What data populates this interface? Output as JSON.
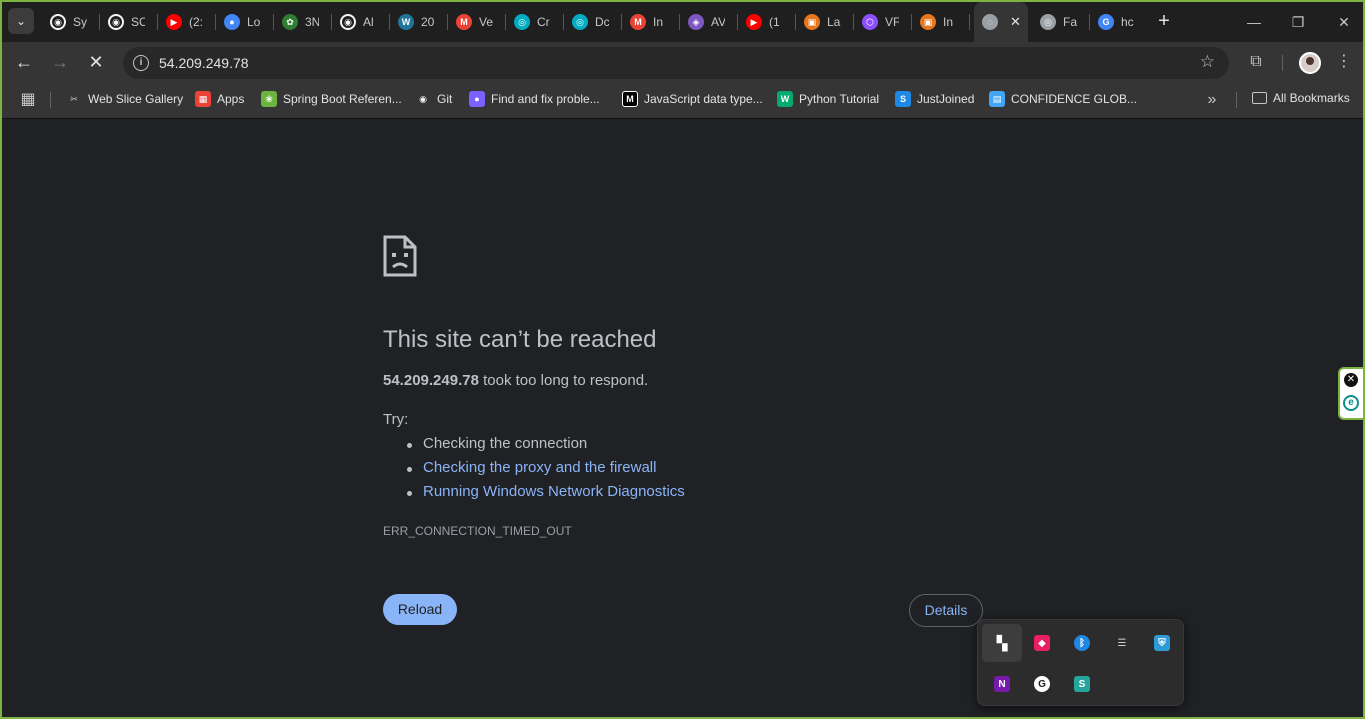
{
  "tabs": [
    {
      "title": "Sy",
      "icon": "github-icon",
      "color": "#f5f5f5"
    },
    {
      "title": "SC",
      "icon": "github-icon",
      "color": "#f5f5f5"
    },
    {
      "title": "(2:",
      "icon": "youtube-icon",
      "color": "#ff0000"
    },
    {
      "title": "Lo",
      "icon": "firebase-icon",
      "color": "#4285f4"
    },
    {
      "title": "3N",
      "icon": "tree-icon",
      "color": "#2e7d32"
    },
    {
      "title": "Al",
      "icon": "github-icon",
      "color": "#f5f5f5"
    },
    {
      "title": "20",
      "icon": "wordpress-icon",
      "color": "#21759b"
    },
    {
      "title": "Ve",
      "icon": "gmail-icon",
      "color": "#ea4335"
    },
    {
      "title": "Cr",
      "icon": "eye-icon",
      "color": "#00acc1"
    },
    {
      "title": "Dc",
      "icon": "eye-icon",
      "color": "#00acc1"
    },
    {
      "title": "In",
      "icon": "gmail-icon",
      "color": "#ea4335"
    },
    {
      "title": "AV",
      "icon": "aws-cube-icon",
      "color": "#7e57c2"
    },
    {
      "title": "(1",
      "icon": "youtube-icon",
      "color": "#ff0000"
    },
    {
      "title": "La",
      "icon": "aws-orange-icon",
      "color": "#e8761c"
    },
    {
      "title": "VF",
      "icon": "vpc-icon",
      "color": "#8c4fff"
    },
    {
      "title": "In",
      "icon": "aws-orange-icon",
      "color": "#e8761c"
    },
    {
      "title": "",
      "icon": "loading-globe-icon",
      "color": "#9aa0a6"
    },
    {
      "title": "Fa",
      "icon": "eye-icon",
      "color": "#9aa0a6"
    },
    {
      "title": "hc",
      "icon": "google-icon",
      "color": "#4285f4"
    }
  ],
  "toolbar": {
    "url": "54.209.249.78"
  },
  "bookmarks": [
    {
      "label": "Web Slice Gallery",
      "icon": "webslice-icon",
      "color": "#cccccc"
    },
    {
      "label": "Apps",
      "icon": "apps-grid-icon",
      "color": "#ea4335"
    },
    {
      "label": "Spring Boot Referen...",
      "icon": "spring-icon",
      "color": "#6db33f"
    },
    {
      "label": "Git",
      "icon": "github-icon",
      "color": "#f5f5f5"
    },
    {
      "label": "Find and fix proble...",
      "icon": "purple-dot-icon",
      "color": "#7b61ff"
    },
    {
      "label": "JavaScript data type...",
      "icon": "mdn-icon",
      "color": "#000000"
    },
    {
      "label": "Python Tutorial",
      "icon": "w3-icon",
      "color": "#04aa6d"
    },
    {
      "label": "JustJoined",
      "icon": "justjoined-icon",
      "color": "#1e88e5"
    },
    {
      "label": "CONFIDENCE GLOB...",
      "icon": "doc-icon",
      "color": "#42a5f5"
    }
  ],
  "all_bookmarks_label": "All Bookmarks",
  "error": {
    "title": "This site can’t be reached",
    "host": "54.209.249.78",
    "message_rest": " took too long to respond.",
    "try_label": "Try:",
    "suggestions": [
      "Checking the connection",
      "Checking the proxy and the firewall",
      "Running Windows Network Diagnostics"
    ],
    "code": "ERR_CONNECTION_TIMED_OUT",
    "reload_label": "Reload",
    "details_label": "Details"
  },
  "tray_icons": [
    {
      "icon": "taskbar-app-icon",
      "color": "#ffffff"
    },
    {
      "icon": "cube-app-icon",
      "color": "#e91e63"
    },
    {
      "icon": "bluetooth-icon",
      "color": "#1e88e5"
    },
    {
      "icon": "speaker-list-icon",
      "color": "#cfcfcf"
    },
    {
      "icon": "security-shield-icon",
      "color": "#2e9ad6"
    },
    {
      "icon": "onenote-icon",
      "color": "#7719aa"
    },
    {
      "icon": "grammarly-icon",
      "color": "#ffffff"
    },
    {
      "icon": "snagit-icon",
      "color": "#26a69a"
    }
  ]
}
